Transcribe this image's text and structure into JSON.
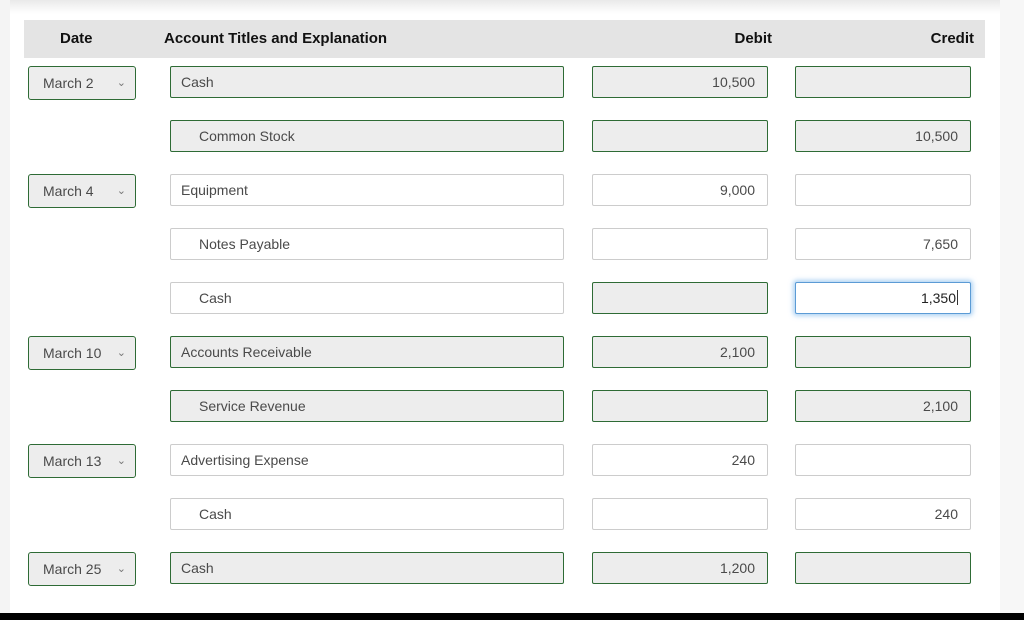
{
  "table": {
    "headers": {
      "date": "Date",
      "account": "Account Titles and Explanation",
      "debit": "Debit",
      "credit": "Credit"
    },
    "colors": {
      "header_band": "#e4e4e4",
      "validated_border": "#2e6b35",
      "validated_fill": "#ededed",
      "plain_border": "#cccccc",
      "focus_border": "#5b9bd5"
    },
    "chevron_glyph": "⌄",
    "rows": [
      {
        "date": "March 2",
        "has_date": true,
        "account": "Cash",
        "indent": false,
        "debit": "10,500",
        "credit": "",
        "account_style": "green",
        "debit_style": "green",
        "credit_style": "green"
      },
      {
        "date": "",
        "has_date": false,
        "account": "Common Stock",
        "indent": true,
        "debit": "",
        "credit": "10,500",
        "account_style": "green",
        "debit_style": "green",
        "credit_style": "green"
      },
      {
        "date": "March 4",
        "has_date": true,
        "account": "Equipment",
        "indent": false,
        "debit": "9,000",
        "credit": "",
        "account_style": "plain",
        "debit_style": "plain",
        "credit_style": "plain"
      },
      {
        "date": "",
        "has_date": false,
        "account": "Notes Payable",
        "indent": true,
        "debit": "",
        "credit": "7,650",
        "account_style": "plain",
        "debit_style": "plain",
        "credit_style": "plain"
      },
      {
        "date": "",
        "has_date": false,
        "account": "Cash",
        "indent": true,
        "debit": "",
        "credit": "1,350",
        "account_style": "plain",
        "debit_style": "green",
        "credit_style": "focus"
      },
      {
        "date": "March 10",
        "has_date": true,
        "account": "Accounts Receivable",
        "indent": false,
        "debit": "2,100",
        "credit": "",
        "account_style": "green",
        "debit_style": "green",
        "credit_style": "green"
      },
      {
        "date": "",
        "has_date": false,
        "account": "Service Revenue",
        "indent": true,
        "debit": "",
        "credit": "2,100",
        "account_style": "green",
        "debit_style": "green",
        "credit_style": "green"
      },
      {
        "date": "March 13",
        "has_date": true,
        "account": "Advertising Expense",
        "indent": false,
        "debit": "240",
        "credit": "",
        "account_style": "plain",
        "debit_style": "plain",
        "credit_style": "plain"
      },
      {
        "date": "",
        "has_date": false,
        "account": "Cash",
        "indent": true,
        "debit": "",
        "credit": "240",
        "account_style": "plain",
        "debit_style": "plain",
        "credit_style": "plain"
      },
      {
        "date": "March 25",
        "has_date": true,
        "account": "Cash",
        "indent": false,
        "debit": "1,200",
        "credit": "",
        "account_style": "green",
        "debit_style": "green",
        "credit_style": "green"
      }
    ]
  }
}
